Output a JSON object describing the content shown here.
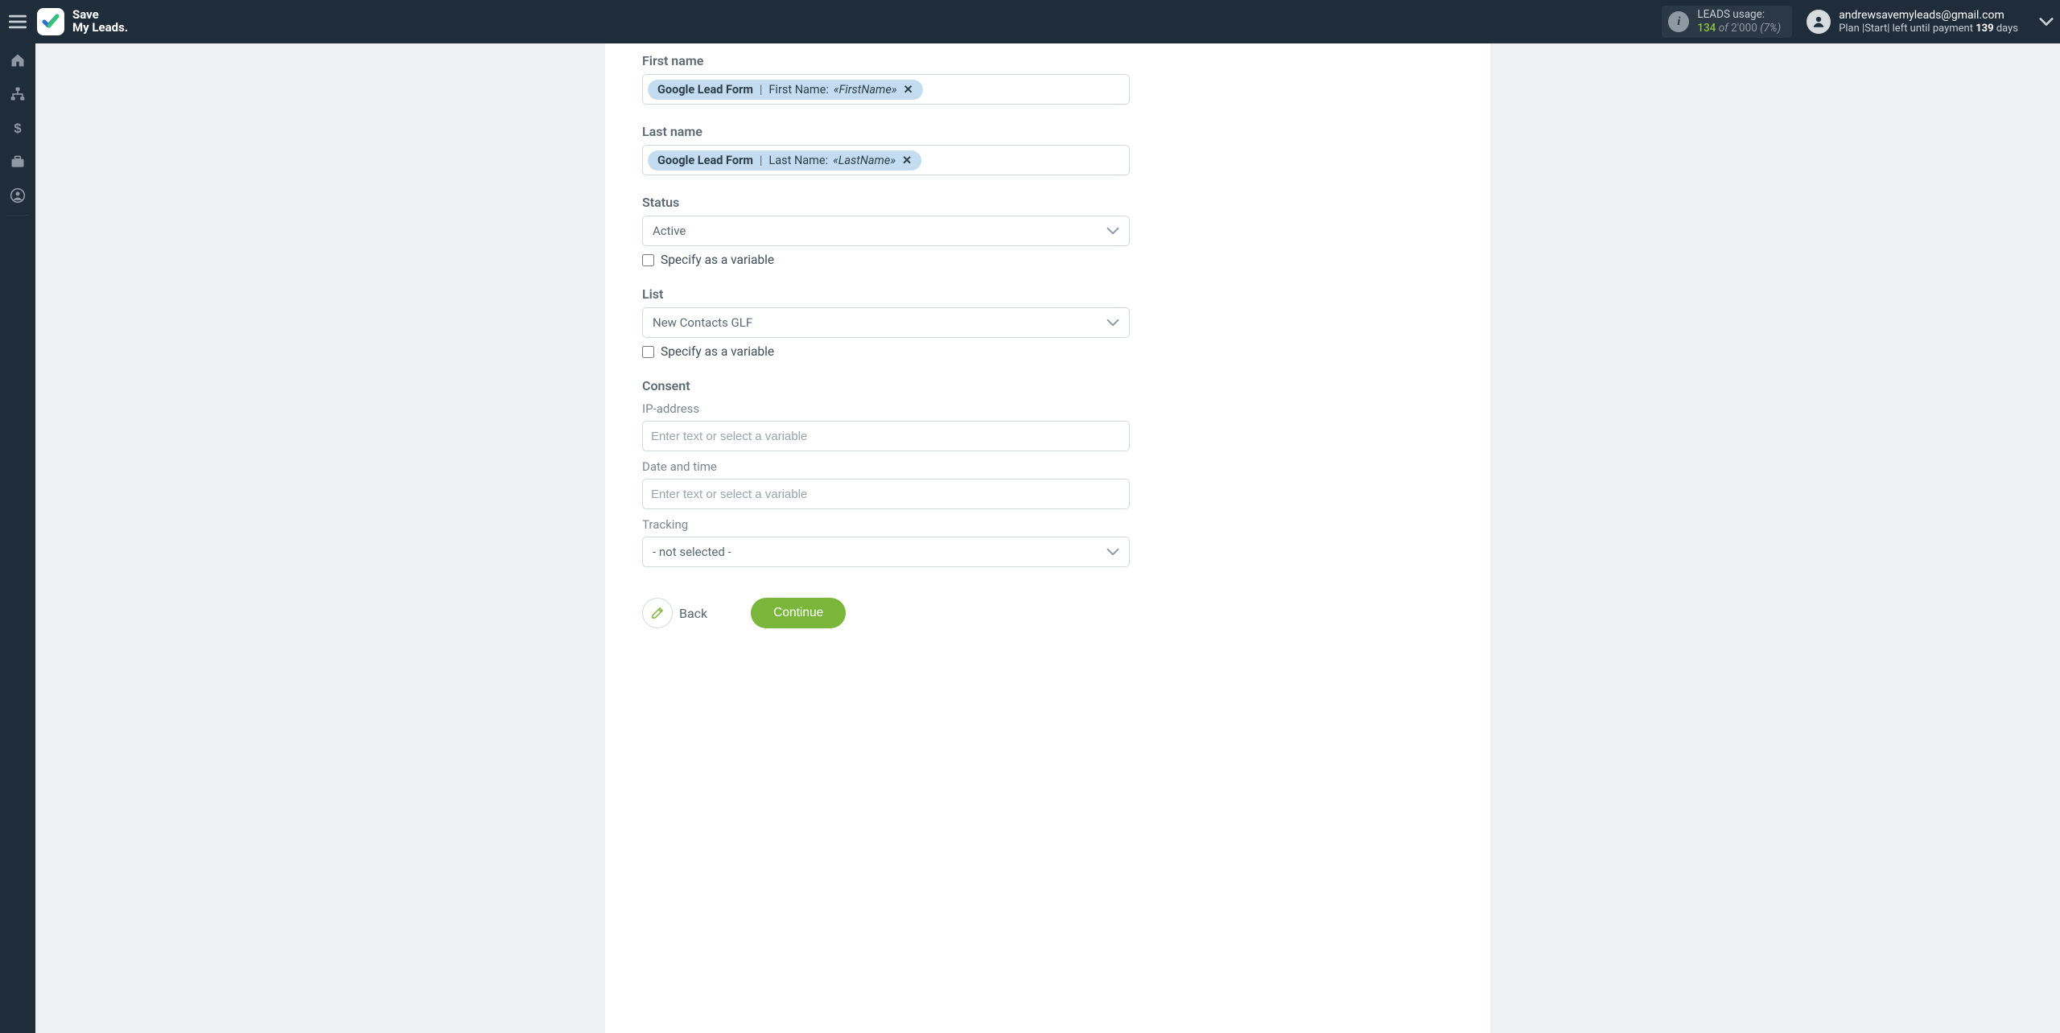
{
  "brand": {
    "line1": "Save",
    "line2": "My Leads."
  },
  "usage": {
    "title": "LEADS usage:",
    "used": "134",
    "of_word": "of",
    "total": "2'000",
    "pct": "(7%)"
  },
  "user": {
    "email": "andrewsavemyleads@gmail.com",
    "plan_prefix": "Plan |Start| left until payment ",
    "plan_number": "139",
    "plan_suffix": " days"
  },
  "form": {
    "first_name": {
      "label": "First name",
      "token_source": "Google Lead Form",
      "token_label": "First Name:",
      "token_value": "«FirstName»"
    },
    "last_name": {
      "label": "Last name",
      "token_source": "Google Lead Form",
      "token_label": "Last Name:",
      "token_value": "«LastName»"
    },
    "status": {
      "label": "Status",
      "value": "Active",
      "specify_label": "Specify as a variable"
    },
    "list": {
      "label": "List",
      "value": "New Contacts GLF",
      "specify_label": "Specify as a variable"
    },
    "consent": {
      "label": "Consent",
      "ip_label": "IP-address",
      "ip_placeholder": "Enter text or select a variable",
      "datetime_label": "Date and time",
      "datetime_placeholder": "Enter text or select a variable",
      "tracking_label": "Tracking",
      "tracking_value": "- not selected -"
    }
  },
  "buttons": {
    "back": "Back",
    "continue": "Continue"
  },
  "token_remove_glyph": "✕"
}
